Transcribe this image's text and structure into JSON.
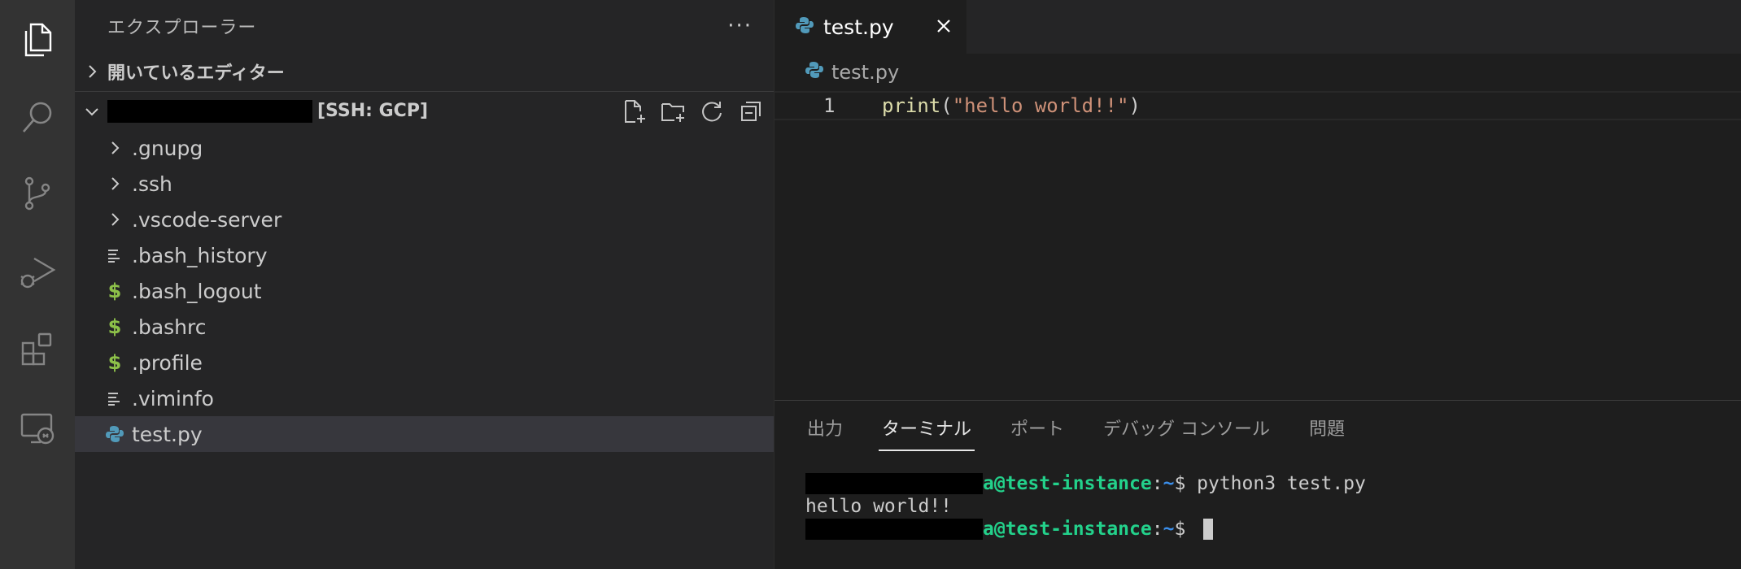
{
  "activity_bar": {
    "icons": [
      "files-icon",
      "search-icon",
      "source-control-icon",
      "run-debug-icon",
      "extensions-icon",
      "remote-explorer-icon"
    ]
  },
  "sidebar": {
    "title": "エクスプローラー",
    "more": "···",
    "open_editors_label": "開いているエディター",
    "workspace_label": "[SSH: GCP]",
    "tree": [
      {
        "name": ".gnupg",
        "kind": "folder"
      },
      {
        "name": ".ssh",
        "kind": "folder"
      },
      {
        "name": ".vscode-server",
        "kind": "folder"
      },
      {
        "name": ".bash_history",
        "kind": "text"
      },
      {
        "name": ".bash_logout",
        "kind": "shell"
      },
      {
        "name": ".bashrc",
        "kind": "shell"
      },
      {
        "name": ".profile",
        "kind": "shell"
      },
      {
        "name": ".viminfo",
        "kind": "text"
      },
      {
        "name": "test.py",
        "kind": "python",
        "selected": true
      }
    ]
  },
  "editor": {
    "tab_label": "test.py",
    "breadcrumb": "test.py",
    "lines": [
      {
        "number": "1",
        "fn": "print",
        "open": "(",
        "string": "\"hello world!!\"",
        "close": ")"
      }
    ]
  },
  "panel": {
    "tabs": [
      "出力",
      "ターミナル",
      "ポート",
      "デバッグ コンソール",
      "問題"
    ],
    "active_tab": "ターミナル",
    "terminal": {
      "host": "a@test-instance",
      "colon": ":",
      "path": "~",
      "prompt": "$ ",
      "command": "python3 test.py",
      "output": "hello world!!"
    }
  },
  "colors": {
    "activity_bg": "#333333",
    "sidebar_bg": "#252526",
    "editor_bg": "#1e1e1e",
    "shell_icon": "#8dc149",
    "python_icon": "#519aba",
    "terminal_host": "#23d18b"
  }
}
